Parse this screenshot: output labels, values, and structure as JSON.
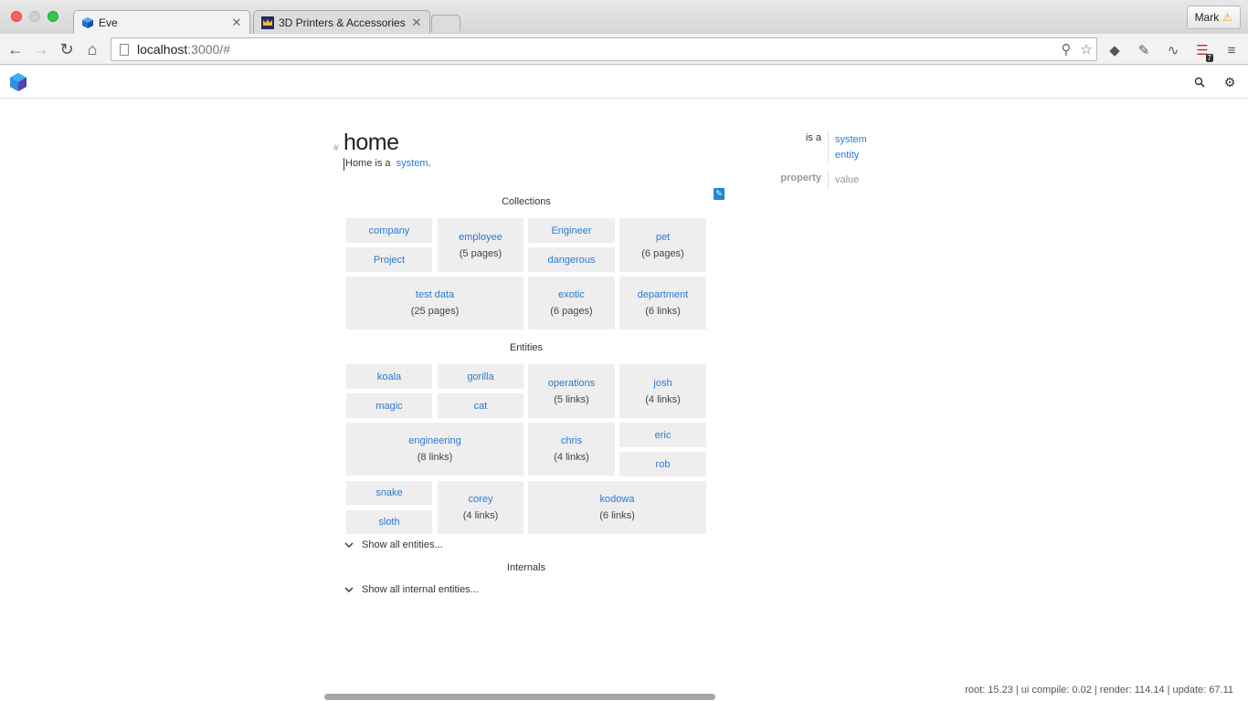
{
  "browser": {
    "tabs": [
      {
        "title": "Eve",
        "active": true
      },
      {
        "title": "3D Printers & Accessories",
        "active": false
      }
    ],
    "profile": {
      "name": "Mark",
      "warning_icon": "warning-icon"
    },
    "url": {
      "host": "localhost",
      "rest": ":3000/#"
    }
  },
  "app": {
    "page_title": "home",
    "hash_mark": "#",
    "description": {
      "prefix": "Home is a",
      "link": "system",
      "suffix": "."
    },
    "properties": {
      "is_a_label": "is a",
      "is_a_values": [
        "system",
        "entity"
      ],
      "property_header": "property",
      "value_header": "value"
    },
    "collections": {
      "title": "Collections",
      "tiles": [
        {
          "name": "company",
          "count": ""
        },
        {
          "name": "Project",
          "count": ""
        },
        {
          "name": "employee",
          "count": "(5 pages)"
        },
        {
          "name": "Engineer",
          "count": ""
        },
        {
          "name": "dangerous",
          "count": ""
        },
        {
          "name": "pet",
          "count": "(6 pages)"
        },
        {
          "name": "test data",
          "count": "(25 pages)"
        },
        {
          "name": "exotic",
          "count": "(6 pages)"
        },
        {
          "name": "department",
          "count": "(6 links)"
        }
      ]
    },
    "entities": {
      "title": "Entities",
      "tiles": [
        {
          "name": "koala",
          "count": ""
        },
        {
          "name": "magic",
          "count": ""
        },
        {
          "name": "gorilla",
          "count": ""
        },
        {
          "name": "cat",
          "count": ""
        },
        {
          "name": "operations",
          "count": "(5 links)"
        },
        {
          "name": "josh",
          "count": "(4 links)"
        },
        {
          "name": "engineering",
          "count": "(8 links)"
        },
        {
          "name": "chris",
          "count": "(4 links)"
        },
        {
          "name": "eric",
          "count": ""
        },
        {
          "name": "rob",
          "count": ""
        },
        {
          "name": "snake",
          "count": ""
        },
        {
          "name": "sloth",
          "count": ""
        },
        {
          "name": "corey",
          "count": "(4 links)"
        },
        {
          "name": "kodowa",
          "count": "(6 links)"
        }
      ],
      "show_all": "Show all entities..."
    },
    "internals": {
      "title": "Internals",
      "show_all": "Show all internal entities..."
    },
    "stats": "root: 15.23 | ui compile: 0.02 | render: 114.14 | update: 67.11"
  },
  "colors": {
    "link": "#2a7ad4",
    "tile_bg": "#eeeeee",
    "edit_button": "#1e88d3"
  }
}
